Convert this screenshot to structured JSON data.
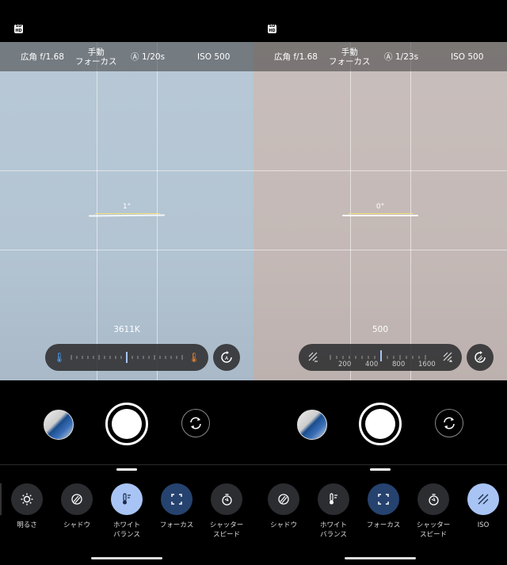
{
  "panels": [
    {
      "topbar": {
        "lens": "広角 f/1.68",
        "focus": "手動\nフォーカス",
        "shutter_mode": "Ⓐ",
        "shutter": "1/20s",
        "iso": "ISO 500"
      },
      "level": "1°",
      "value": "3611K",
      "tools": [
        {
          "label": "明るさ",
          "icon": "brightness-icon",
          "state": "normal"
        },
        {
          "label": "シャドウ",
          "icon": "shadow-icon",
          "state": "normal"
        },
        {
          "label": "ホワイト\nバランス",
          "icon": "thermometer-icon",
          "state": "selected"
        },
        {
          "label": "フォーカス",
          "icon": "focus-icon",
          "state": "active"
        },
        {
          "label": "シャッター\nスピード",
          "icon": "shutter-speed-icon",
          "state": "normal"
        }
      ]
    },
    {
      "topbar": {
        "lens": "広角 f/1.68",
        "focus": "手動\nフォーカス",
        "shutter_mode": "Ⓐ",
        "shutter": "1/23s",
        "iso": "ISO 500"
      },
      "level": "0°",
      "value": "500",
      "scale": [
        "200",
        "400",
        "800",
        "1600"
      ],
      "tools": [
        {
          "label": "シャドウ",
          "icon": "shadow-icon",
          "state": "normal"
        },
        {
          "label": "ホワイト\nバランス",
          "icon": "thermometer-icon",
          "state": "normal"
        },
        {
          "label": "フォーカス",
          "icon": "focus-icon",
          "state": "active"
        },
        {
          "label": "シャッター\nスピード",
          "icon": "shutter-speed-icon",
          "state": "normal"
        },
        {
          "label": "ISO",
          "icon": "iso-icon",
          "state": "selected"
        }
      ]
    }
  ],
  "colors": {
    "selected": "#a8c4f5",
    "active": "#26436f",
    "cool": "#4aa3ff",
    "warm": "#ff8a2a"
  }
}
